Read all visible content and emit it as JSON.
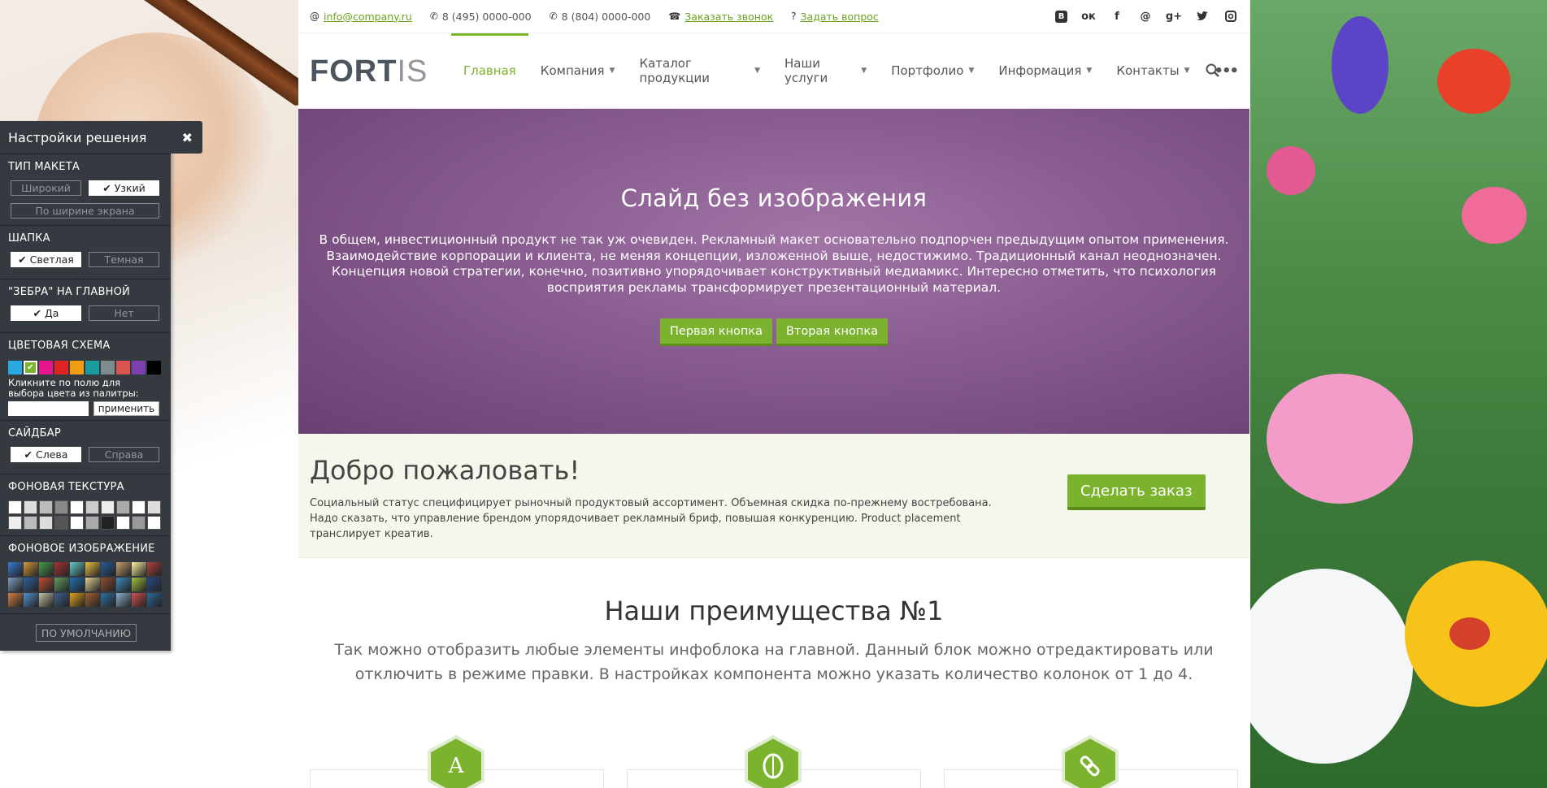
{
  "topbar": {
    "email": "info@company.ru",
    "phone1": "8 (495) 0000-000",
    "phone2": "8 (804) 0000-000",
    "callback": "Заказать звонок",
    "question": "Задать вопрос",
    "socials": [
      "vk-icon",
      "ok-icon",
      "facebook-icon",
      "mail-icon",
      "googleplus-icon",
      "twitter-icon",
      "instagram-icon"
    ]
  },
  "logo": {
    "part1": "FORT",
    "part2": "IS"
  },
  "nav": {
    "items": [
      {
        "label": "Главная",
        "active": true
      },
      {
        "label": "Компания"
      },
      {
        "label": "Каталог продукции"
      },
      {
        "label": "Наши услуги"
      },
      {
        "label": "Портфолио"
      },
      {
        "label": "Информация"
      },
      {
        "label": "Контакты"
      }
    ],
    "more": "•••"
  },
  "slide": {
    "title": "Слайд без изображения",
    "text": "В общем, инвестиционный продукт не так уж очевиден. Рекламный макет основательно подпорчен предыдущим опытом применения. Взаимодействие корпорации и клиента, не меняя концепции, изложенной выше, недостижимо. Традиционный канал неоднозначен. Концепция новой стратегии, конечно, позитивно упорядочивает конструктивный медиамикс. Интересно отметить, что психология восприятия рекламы трансформирует презентационный материал.",
    "button1": "Первая кнопка",
    "button2": "Вторая кнопка"
  },
  "welcome": {
    "title": "Добро пожаловать!",
    "text": "Социальный статус специфицирует рыночный продуктовый ассортимент. Объемная скидка по-прежнему востребована. Надо сказать, что управление брендом упорядочивает рекламный бриф, повышая конкуренцию. Product placement транслирует креатив.",
    "order_button": "Сделать заказ"
  },
  "advantages": {
    "title": "Наши преимущества №1",
    "text": "Так можно отобразить любые элементы инфоблока на главной. Данный блок можно отредактировать или отключить в режиме правки. В настройках компонента можно указать количество колонок от 1 до 4.",
    "cards": [
      {
        "icon": "letter-a-icon",
        "glyph": "A"
      },
      {
        "icon": "leaf-icon",
        "glyph": ""
      },
      {
        "icon": "link-icon",
        "glyph": ""
      }
    ]
  },
  "settings": {
    "title": "Настройки решения",
    "layout_title": "ТИП МАКЕТА",
    "layout_wide": "Широкий",
    "layout_narrow": "Узкий",
    "layout_full": "По ширине экрана",
    "header_title": "ШАПКА",
    "header_light": "Светлая",
    "header_dark": "Темная",
    "zebra_title": "\"ЗЕБРА\" НА ГЛАВНОЙ",
    "zebra_yes": "Да",
    "zebra_no": "Нет",
    "color_title": "ЦВЕТОВАЯ СХЕМА",
    "colors": [
      "#29a9e1",
      "#7bb32e",
      "#e5168c",
      "#e02424",
      "#f39c12",
      "#1b9aa0",
      "#7f8c8d",
      "#d9534f",
      "#7b3fb0",
      "#000000"
    ],
    "color_hint": "Кликните по полю для выбора цвета из палитры:",
    "apply": "применить",
    "sidebar_title": "САЙДБАР",
    "sidebar_left": "Слева",
    "sidebar_right": "Справа",
    "texture_title": "ФОНОВАЯ ТЕКСТУРА",
    "image_title": "ФОНОВОЕ ИЗОБРАЖЕНИЕ",
    "default": "ПО УМОЛЧАНИЮ"
  }
}
